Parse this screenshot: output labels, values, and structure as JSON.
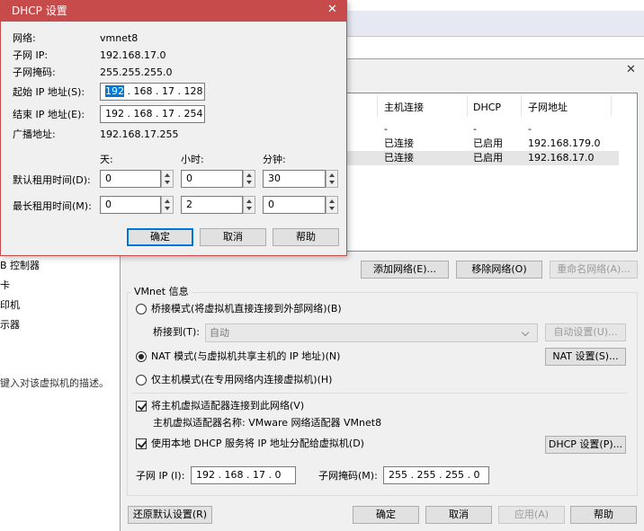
{
  "background_window": {
    "left_items": [
      "B 控制器",
      "卡",
      "印机",
      "示器"
    ],
    "description_text": "键入对该虚拟机的描述。",
    "close_glyph": "✕"
  },
  "network_editor": {
    "table": {
      "headers": [
        "主机连接",
        "DHCP",
        "子网地址"
      ],
      "rows": [
        [
          "-",
          "-",
          "-"
        ],
        [
          "已连接",
          "已启用",
          "192.168.179.0"
        ],
        [
          "已连接",
          "已启用",
          "192.168.17.0"
        ]
      ]
    },
    "add_network_label": "添加网络(E)...",
    "remove_network_label": "移除网络(O)",
    "rename_network_label": "重命名网络(A)...",
    "vmnet_info_title": "VMnet 信息",
    "bridge_mode_label": "桥接模式(将虚拟机直接连接到外部网络)(B)",
    "bridge_to_label": "桥接到(T):",
    "bridge_to_value": "自动",
    "auto_settings_label": "自动设置(U)...",
    "nat_mode_label": "NAT 模式(与虚拟机共享主机的 IP 地址)(N)",
    "nat_settings_label": "NAT 设置(S)...",
    "host_only_label": "仅主机模式(在专用网络内连接虚拟机)(H)",
    "connect_adapter_label": "将主机虚拟适配器连接到此网络(V)",
    "adapter_name_label": "主机虚拟适配器名称: VMware 网络适配器 VMnet8",
    "use_dhcp_label": "使用本地 DHCP 服务将 IP 地址分配给虚拟机(D)",
    "dhcp_settings_label": "DHCP 设置(P)...",
    "subnet_ip_label": "子网 IP (I):",
    "subnet_ip_value": "192 . 168 .  17  .   0",
    "subnet_mask_label": "子网掩码(M):",
    "subnet_mask_value": "255 . 255 . 255 .   0",
    "restore_defaults_label": "还原默认设置(R)",
    "ok_label": "确定",
    "cancel_label": "取消",
    "apply_label": "应用(A)",
    "help_label": "帮助"
  },
  "dhcp_dialog": {
    "title": "DHCP 设置",
    "close_glyph": "✕",
    "network_label": "网络:",
    "network_value": "vmnet8",
    "subnet_ip_label": "子网 IP:",
    "subnet_ip_value": "192.168.17.0",
    "subnet_mask_label": "子网掩码:",
    "subnet_mask_value": "255.255.255.0",
    "start_ip_label": "起始 IP 地址(S):",
    "start_ip_selected": "192",
    "start_ip_rest": " . 168 .  17  . 128",
    "end_ip_label": "结束 IP 地址(E):",
    "end_ip_value": "192 . 168 .  17  . 254",
    "broadcast_label": "广播地址:",
    "broadcast_value": "192.168.17.255",
    "days_label": "天:",
    "hours_label": "小时:",
    "minutes_label": "分钟:",
    "default_lease_label": "默认租用时间(D):",
    "default_lease": {
      "days": "0",
      "hours": "0",
      "minutes": "30"
    },
    "max_lease_label": "最长租用时间(M):",
    "max_lease": {
      "days": "0",
      "hours": "2",
      "minutes": "0"
    },
    "ok_label": "确定",
    "cancel_label": "取消",
    "help_label": "帮助"
  }
}
